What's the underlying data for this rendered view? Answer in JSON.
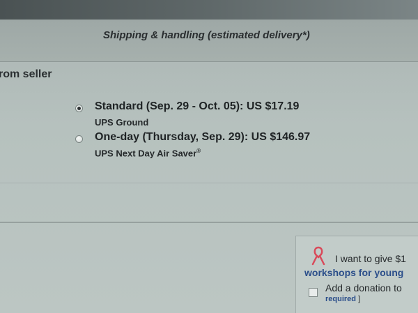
{
  "header": {
    "title": "Shipping & handling (estimated delivery*)"
  },
  "seller": {
    "label": "rom seller"
  },
  "shipping_options": [
    {
      "label": "Standard (Sep. 29 - Oct. 05): US $17.19",
      "service": "UPS Ground",
      "selected": true
    },
    {
      "label": "One-day (Thursday, Sep. 29): US $146.97",
      "service": "UPS Next Day Air Saver",
      "service_mark": "®",
      "selected": false
    }
  ],
  "donation": {
    "give_text": "I want to give $1",
    "workshops_text": "workshops for young",
    "checkbox_label": "Add a donation to",
    "required_text": "required",
    "required_bracket": "]",
    "ribbon_color": "#d94a5a",
    "link_color": "#2b4e8a"
  },
  "icons": {
    "ribbon": "awareness-ribbon-icon",
    "radio": "radio-button",
    "checkbox": "checkbox"
  }
}
